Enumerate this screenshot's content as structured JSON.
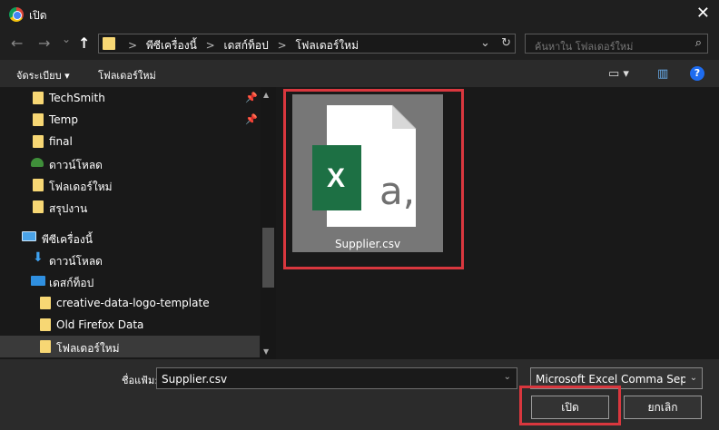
{
  "window": {
    "title": "เปิด",
    "close": "✕"
  },
  "nav": {
    "back": "←",
    "forward": "→",
    "recent": "⌄",
    "up": "↑"
  },
  "address": {
    "crumbs": [
      "พีซีเครื่องนี้",
      "เดสก์ท็อป",
      "โฟลเดอร์ใหม่"
    ],
    "sep": ">",
    "dropdown": "⌄",
    "refresh": "↻"
  },
  "search": {
    "placeholder": "ค้นหาใน โฟลเดอร์ใหม่",
    "icon": "⌕"
  },
  "toolbar": {
    "organize": "จัดระเบียบ ▾",
    "new_folder": "โฟลเดอร์ใหม่",
    "view": "▭ ▾",
    "pane": "▥",
    "help": "?"
  },
  "sidebar": {
    "items": [
      {
        "label": "TechSmith",
        "pin": "📌"
      },
      {
        "label": "Temp",
        "pin": "📌"
      },
      {
        "label": "final"
      },
      {
        "label": "ดาวน์โหลด"
      },
      {
        "label": "โฟลเดอร์ใหม่"
      },
      {
        "label": "สรุปงาน"
      },
      {
        "label": "พีซีเครื่องนี้"
      },
      {
        "label": "ดาวน์โหลด"
      },
      {
        "label": "เดสก์ท็อป"
      },
      {
        "label": "creative-data-logo-template"
      },
      {
        "label": "Old Firefox Data"
      },
      {
        "label": "โฟลเดอร์ใหม่"
      }
    ],
    "scroll_up": "▲",
    "scroll_down": "▼"
  },
  "files": [
    {
      "name": "Supplier.csv",
      "badge": "X",
      "glyph": "a,"
    }
  ],
  "bottom": {
    "filename_label": "ชื่อแฟ้ม:",
    "filename_value": "Supplier.csv",
    "filename_chev": "⌄",
    "filetype_value": "Microsoft Excel Comma Separated Values File",
    "filetype_chev": "⌄",
    "open_label": "เปิด",
    "cancel_label": "ยกเลิก"
  },
  "colors": {
    "highlight": "#d9373e",
    "excel_green": "#1d7044",
    "folder": "#f7d774"
  }
}
